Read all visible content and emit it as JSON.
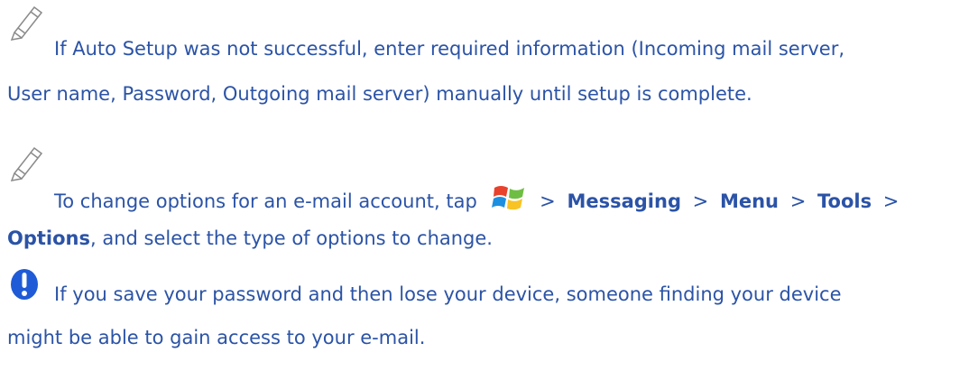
{
  "colors": {
    "text": "#2b53a6",
    "pencil_outline": "#8a8a8a",
    "alert_blue": "#1f5bd6"
  },
  "note1": {
    "icon": "pencil-note-icon",
    "line1": "If Auto Setup was not successful, enter required information (Incoming mail server,",
    "line2": "User name, Password, Outgoing mail server) manually until setup is complete."
  },
  "note2": {
    "icon": "pencil-note-icon",
    "start_icon": "windows-start-icon",
    "text_before_icon": "To change options for an e-mail account, tap",
    "sep1": ">",
    "messaging": "Messaging",
    "sep2": ">",
    "menu": "Menu",
    "sep3": ">",
    "tools": "Tools",
    "sep4": ">",
    "options": "Options",
    "text_after": ", and select the type of options to change."
  },
  "warning": {
    "icon": "exclamation-alert-icon",
    "line1": "If you save your password and then lose your device, someone finding your device",
    "line2": "might be able to gain access to your e-mail."
  }
}
